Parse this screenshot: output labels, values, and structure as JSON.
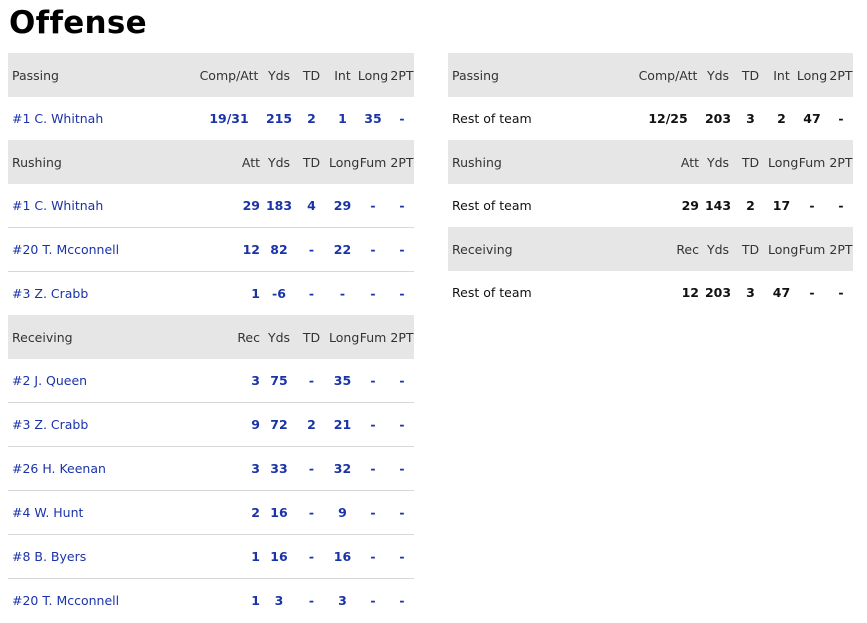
{
  "title": "Offense",
  "left": {
    "sections": [
      {
        "label": "Passing",
        "cols": [
          "Comp/Att",
          "Yds",
          "TD",
          "Int",
          "Long",
          "2PT"
        ],
        "rows": [
          {
            "name": "#1 C. Whitnah",
            "vals": [
              "19/31",
              "215",
              "2",
              "1",
              "35",
              "-"
            ]
          }
        ]
      },
      {
        "label": "Rushing",
        "cols": [
          "Att",
          "Yds",
          "TD",
          "Long",
          "Fum",
          "2PT"
        ],
        "rows": [
          {
            "name": "#1 C. Whitnah",
            "vals": [
              "29",
              "183",
              "4",
              "29",
              "-",
              "-"
            ]
          },
          {
            "name": "#20 T. Mcconnell",
            "vals": [
              "12",
              "82",
              "-",
              "22",
              "-",
              "-"
            ]
          },
          {
            "name": "#3 Z. Crabb",
            "vals": [
              "1",
              "-6",
              "-",
              "-",
              "-",
              "-"
            ]
          }
        ]
      },
      {
        "label": "Receiving",
        "cols": [
          "Rec",
          "Yds",
          "TD",
          "Long",
          "Fum",
          "2PT"
        ],
        "rows": [
          {
            "name": "#2 J. Queen",
            "vals": [
              "3",
              "75",
              "-",
              "35",
              "-",
              "-"
            ]
          },
          {
            "name": "#3 Z. Crabb",
            "vals": [
              "9",
              "72",
              "2",
              "21",
              "-",
              "-"
            ]
          },
          {
            "name": "#26 H. Keenan",
            "vals": [
              "3",
              "33",
              "-",
              "32",
              "-",
              "-"
            ]
          },
          {
            "name": "#4 W. Hunt",
            "vals": [
              "2",
              "16",
              "-",
              "9",
              "-",
              "-"
            ]
          },
          {
            "name": "#8 B. Byers",
            "vals": [
              "1",
              "16",
              "-",
              "16",
              "-",
              "-"
            ]
          },
          {
            "name": "#20 T. Mcconnell",
            "vals": [
              "1",
              "3",
              "-",
              "3",
              "-",
              "-"
            ]
          }
        ]
      }
    ]
  },
  "right": {
    "sections": [
      {
        "label": "Passing",
        "cols": [
          "Comp/Att",
          "Yds",
          "TD",
          "Int",
          "Long",
          "2PT"
        ],
        "rows": [
          {
            "name": "Rest of team",
            "vals": [
              "12/25",
              "203",
              "3",
              "2",
              "47",
              "-"
            ]
          }
        ]
      },
      {
        "label": "Rushing",
        "cols": [
          "Att",
          "Yds",
          "TD",
          "Long",
          "Fum",
          "2PT"
        ],
        "rows": [
          {
            "name": "Rest of team",
            "vals": [
              "29",
              "143",
              "2",
              "17",
              "-",
              "-"
            ]
          }
        ]
      },
      {
        "label": "Receiving",
        "cols": [
          "Rec",
          "Yds",
          "TD",
          "Long",
          "Fum",
          "2PT"
        ],
        "rows": [
          {
            "name": "Rest of team",
            "vals": [
              "12",
              "203",
              "3",
              "47",
              "-",
              "-"
            ]
          }
        ]
      }
    ]
  }
}
